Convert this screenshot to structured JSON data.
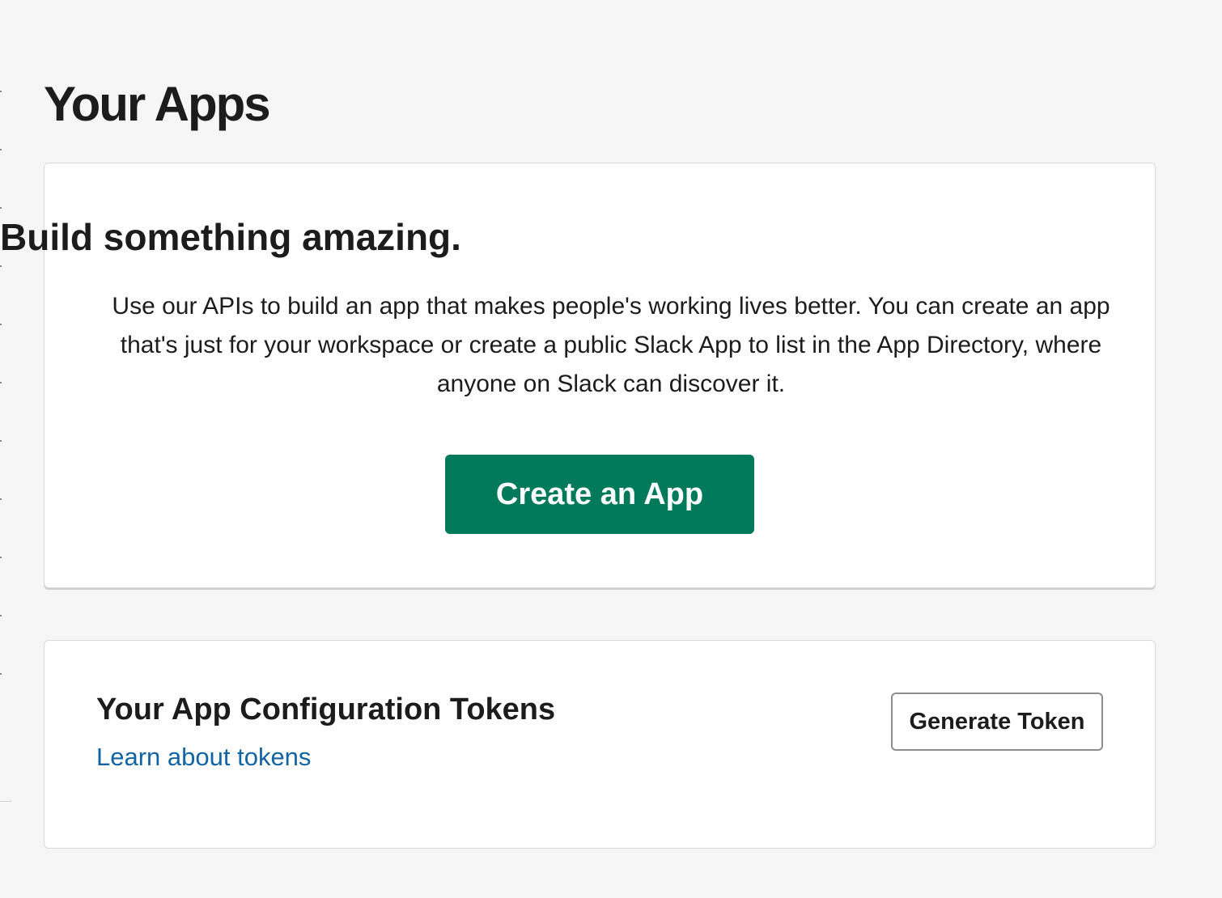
{
  "page": {
    "title": "Your Apps"
  },
  "hero": {
    "title": "Build something amazing.",
    "description": "Use our APIs to build an app that makes people's working lives better. You can create an app that's just for your workspace or create a public Slack App to list in the App Directory, where anyone on Slack can discover it.",
    "create_button_label": "Create an App",
    "button_color": "#007a5a"
  },
  "tokens": {
    "title": "Your App Configuration Tokens",
    "learn_link": "Learn about tokens",
    "generate_button_label": "Generate Token",
    "link_color": "#1264a3"
  }
}
